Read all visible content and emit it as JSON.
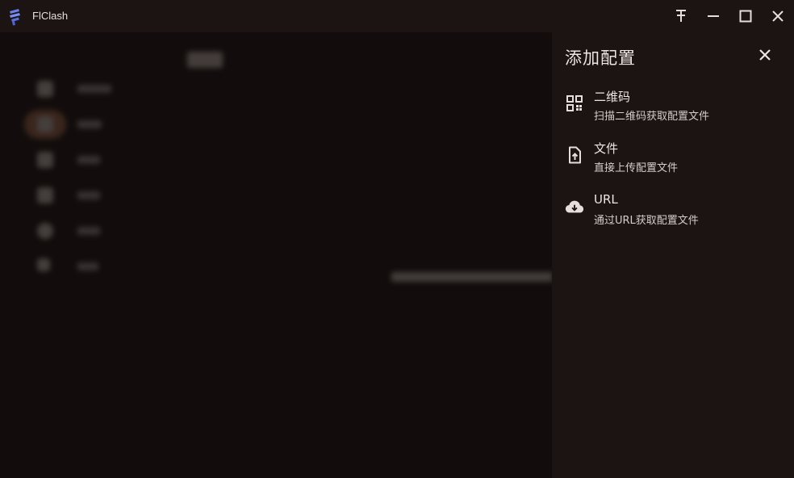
{
  "app": {
    "title": "FlClash"
  },
  "window_controls": {
    "pin_icon": "pin-icon",
    "minimize_icon": "minimize-icon",
    "maximize_icon": "maximize-icon",
    "close_icon": "close-icon"
  },
  "panel": {
    "title": "添加配置",
    "options": [
      {
        "icon": "qr-code-icon",
        "title": "二维码",
        "subtitle": "扫描二维码获取配置文件"
      },
      {
        "icon": "file-upload-icon",
        "title": "文件",
        "subtitle": "直接上传配置文件"
      },
      {
        "icon": "cloud-download-icon",
        "title": "URL",
        "subtitle": "通过URL获取配置文件"
      }
    ]
  },
  "colors": {
    "background": "#120d0c",
    "panel": "#1b1413",
    "text": "#ede5e2",
    "nav_active": "#5b3a2a"
  }
}
